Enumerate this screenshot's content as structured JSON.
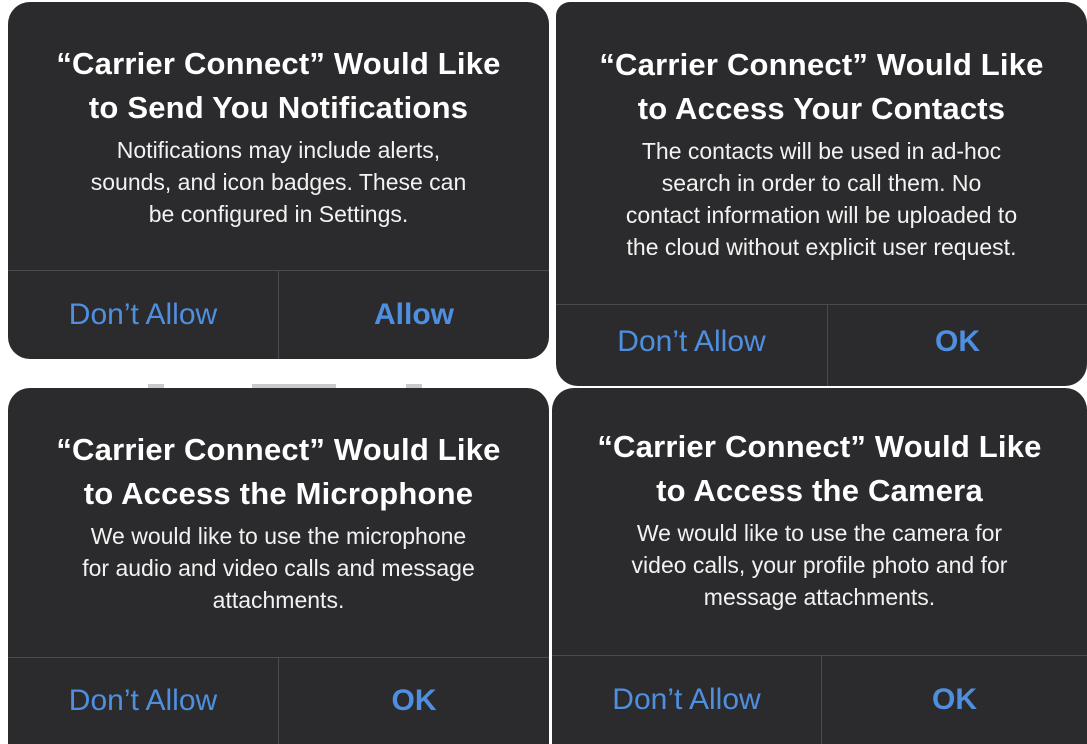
{
  "colors": {
    "background": "#ffffff",
    "alert_background": "#2b2b2d",
    "separator": "#4b4b4f",
    "button_text": "#4f8fe0",
    "title_text": "#ffffff"
  },
  "alerts": [
    {
      "title_line1": "“Carrier Connect” Would Like",
      "title_line2": "to Send You Notifications",
      "message_lines": [
        "Notifications may include alerts,",
        "sounds, and icon badges. These can",
        "be configured in Settings."
      ],
      "deny_label": "Don’t Allow",
      "confirm_label": "Allow"
    },
    {
      "title_line1": "“Carrier Connect” Would Like",
      "title_line2": "to Access Your Contacts",
      "message_lines": [
        "The contacts will be used in ad-hoc",
        "search in order to call them. No",
        "contact information will be uploaded to",
        "the cloud without explicit user request."
      ],
      "deny_label": "Don’t Allow",
      "confirm_label": "OK"
    },
    {
      "title_line1": "“Carrier Connect” Would Like",
      "title_line2": "to Access the Microphone",
      "message_lines": [
        "We would like to use the microphone",
        "for audio and video calls and message",
        "attachments."
      ],
      "deny_label": "Don’t Allow",
      "confirm_label": "OK"
    },
    {
      "title_line1": "“Carrier Connect” Would Like",
      "title_line2": "to Access the Camera",
      "message_lines": [
        "We would like to use the camera for",
        "video calls, your profile photo and for",
        "message attachments."
      ],
      "deny_label": "Don’t Allow",
      "confirm_label": "OK"
    }
  ]
}
